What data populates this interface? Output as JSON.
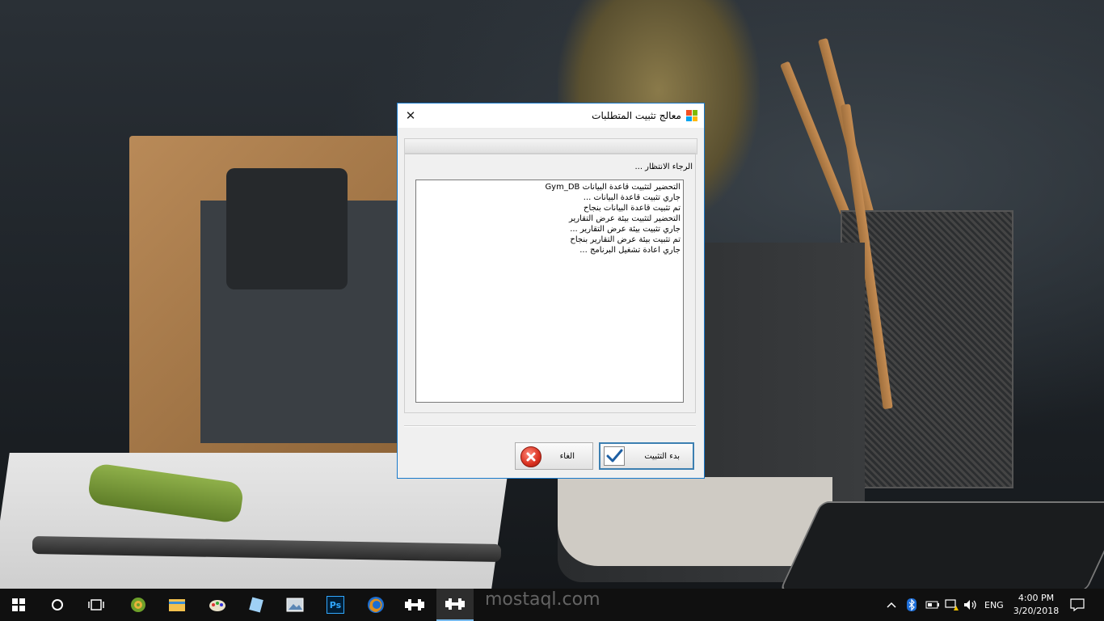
{
  "dialog": {
    "title": "معالج تثبيت المتطلبات",
    "close_glyph": "✕",
    "wait_label": "الرجاء الانتظار ...",
    "log_lines": [
      "التحضير لتثبيت قاعدة البيانات Gym_DB",
      "جاري تثبيت قاعدة البيانات ...",
      "تم تثبيت قاعدة البيانات بنجاح",
      "التحضير لتثبيت بيئة عرض التقارير",
      "جاري تثبيت بيئة عرض التقارير ...",
      "تم تثبيت بيئة عرض التقارير بنجاح",
      "جاري اعادة تشغيل البرنامج ..."
    ],
    "install_button": "بدء التثبيت",
    "cancel_button": "الغاء",
    "accent_color": "#1979ca"
  },
  "taskbar": {
    "language": "ENG",
    "time": "4:00 PM",
    "date": "3/20/2018",
    "apps": [
      "start-icon",
      "cortana-icon",
      "task-view-icon",
      "app-spiral-icon",
      "file-explorer-icon",
      "paint-icon",
      "notes-icon",
      "image-app-icon",
      "photoshop-icon",
      "firefox-icon",
      "gym-app-icon",
      "gym-app-icon-active"
    ],
    "photoshop_label": "Ps"
  },
  "watermark": "mostaql.com"
}
